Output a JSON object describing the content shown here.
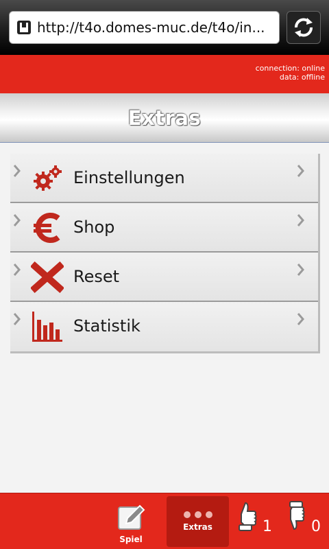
{
  "browser": {
    "url": "http://t4o.domes-muc.de/t4o/in..."
  },
  "status": {
    "connection": "connection: online",
    "data": "data: offline"
  },
  "header": {
    "title": "Extras"
  },
  "menu": {
    "items": [
      {
        "label": "Einstellungen",
        "icon": "gears-icon"
      },
      {
        "label": "Shop",
        "icon": "euro-icon"
      },
      {
        "label": "Reset",
        "icon": "x-icon"
      },
      {
        "label": "Statistik",
        "icon": "bar-chart-icon"
      }
    ]
  },
  "tabbar": {
    "spiel_label": "Spiel",
    "extras_label": "Extras",
    "thumbs_up_count": "1",
    "thumbs_down_count": "0"
  },
  "colors": {
    "accent_red": "#e3281c",
    "icon_red": "#c0281d"
  }
}
